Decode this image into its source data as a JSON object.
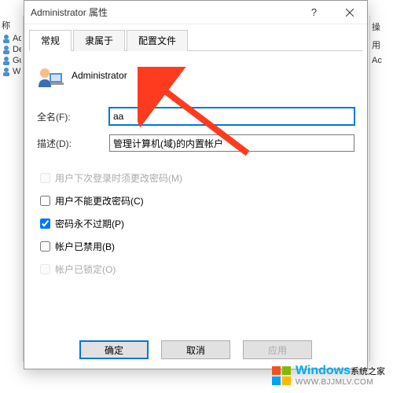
{
  "background": {
    "sidebar_header": "称",
    "sidebar_items": [
      "Admini",
      "Defa",
      "Gues",
      "WDA"
    ],
    "right_header": "操",
    "right_sub": "用",
    "right_item": "Ac"
  },
  "dialog": {
    "title": "Administrator 属性",
    "tabs": [
      "常规",
      "隶属于",
      "配置文件"
    ],
    "active_tab": 0,
    "user": {
      "name": "Administrator"
    },
    "fields": {
      "fullname_label": "全名(F):",
      "fullname_value": "aa",
      "description_label": "描述(D):",
      "description_value": "管理计算机(域)的内置帐户"
    },
    "checks": {
      "must_change": {
        "label": "用户下次登录时须更改密码(M)",
        "checked": false,
        "disabled": true
      },
      "cannot_change": {
        "label": "用户不能更改密码(C)",
        "checked": false,
        "disabled": false
      },
      "never_expire": {
        "label": "密码永不过期(P)",
        "checked": true,
        "disabled": false
      },
      "disabled_acct": {
        "label": "帐户已禁用(B)",
        "checked": false,
        "disabled": false
      },
      "locked_out": {
        "label": "帐户已锁定(O)",
        "checked": false,
        "disabled": true
      }
    },
    "buttons": {
      "ok": "确定",
      "cancel": "取消",
      "apply": "应用"
    }
  },
  "watermark": {
    "brand": "Windows",
    "suffix": "系统之家",
    "url": "WWW.BJJMLV.COM"
  }
}
